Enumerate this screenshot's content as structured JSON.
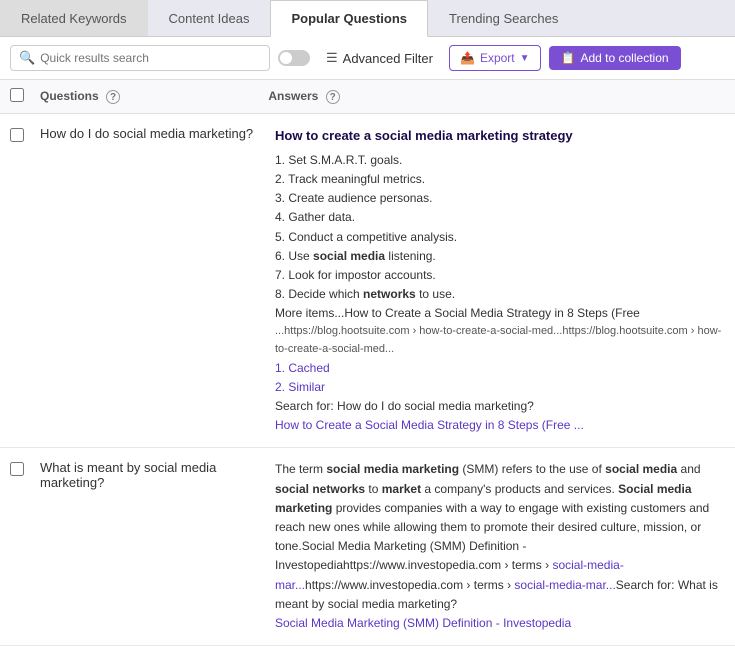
{
  "tabs": [
    {
      "id": "related-keywords",
      "label": "Related Keywords",
      "active": false
    },
    {
      "id": "content-ideas",
      "label": "Content Ideas",
      "active": false
    },
    {
      "id": "popular-questions",
      "label": "Popular Questions",
      "active": true
    },
    {
      "id": "trending-searches",
      "label": "Trending Searches",
      "active": false
    }
  ],
  "toolbar": {
    "search_placeholder": "Quick results search",
    "advanced_filter_label": "Advanced Filter",
    "export_label": "Export",
    "add_collection_label": "Add to collection"
  },
  "table": {
    "col_questions": "Questions",
    "col_answers": "Answers",
    "rows": [
      {
        "question": "How do I do social media marketing?",
        "answer_title": "How to create a social media marketing strategy",
        "answer_lines": [
          "1. Set S.M.A.R.T. goals.",
          "2. Track meaningful metrics.",
          "3. Create audience personas.",
          "4. Gather data.",
          "5. Conduct a competitive analysis.",
          "6. Use social media listening.",
          "7. Look for impostor accounts.",
          "8. Decide which networks to use.",
          "More items...How to Create a Social Media Strategy in 8 Steps (Free",
          "...https://blog.hootsuite.com › how-to-create-a-social-med...https://blog.hootsuite.com › how-to-create-a-social-med...",
          "1. Cached",
          "2. Similar",
          "Search for: How do I do social media marketing?"
        ],
        "answer_link": "How to Create a Social Media Strategy in 8 Steps (Free ..."
      },
      {
        "question": "What is meant by social media marketing?",
        "answer_title": null,
        "answer_lines": [
          "The term social media marketing (SMM) refers to the use of social media and social networks to market a company's products and services. Social media marketing provides companies with a way to engage with existing customers and reach new ones while allowing them to promote their desired culture, mission, or tone.Social Media Marketing (SMM) Definition - Investopediahttps://www.investopedia.com › terms › social-media-mar...https://www.investopedia.com › terms › social-media-mar...Search for: What is meant by social media marketing?"
        ],
        "answer_link": "Social Media Marketing (SMM) Definition - Investopedia"
      }
    ]
  }
}
